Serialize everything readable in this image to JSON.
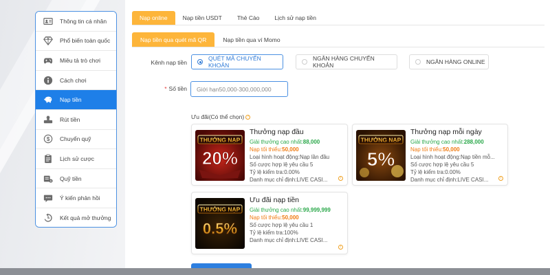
{
  "sidebar": {
    "items": [
      {
        "label": "Thông tin cá nhân",
        "icon": "user-card-icon",
        "active": false
      },
      {
        "label": "Phổ biến toàn quốc",
        "icon": "diamond-icon",
        "active": false
      },
      {
        "label": "Miêu tả trò chơi",
        "icon": "gamepad-icon",
        "active": false
      },
      {
        "label": "Cách chơi",
        "icon": "info-icon",
        "active": false
      },
      {
        "label": "Nạp tiền",
        "icon": "piggy-bank-icon",
        "active": true
      },
      {
        "label": "Rút tiền",
        "icon": "withdraw-icon",
        "active": false
      },
      {
        "label": "Chuyển quỹ",
        "icon": "dollar-icon",
        "active": false
      },
      {
        "label": "Lịch sử cược",
        "icon": "clipboard-icon",
        "active": false
      },
      {
        "label": "Quỹ tiền",
        "icon": "money-stack-icon",
        "active": false
      },
      {
        "label": "Ý kiến phản hồi",
        "icon": "chat-icon",
        "active": false
      },
      {
        "label": "Kết quả mở thưởng",
        "icon": "history-icon",
        "active": false
      }
    ],
    "active_color": "#1e7fe8"
  },
  "tabs": [
    {
      "label": "Nạp online",
      "active": true
    },
    {
      "label": "Nạp tiền USDT",
      "active": false
    },
    {
      "label": "Thẻ Cào",
      "active": false
    },
    {
      "label": "Lịch sử nạp tiền",
      "active": false
    }
  ],
  "subtabs": [
    {
      "label": "Nạp tiền qua quét mã QR",
      "active": true
    },
    {
      "label": "Nạp tiền qua ví Momo",
      "active": false
    }
  ],
  "accent_color": "#fdb53a",
  "form": {
    "channel_label": "Kênh nạp tiền",
    "channels": [
      {
        "label": "QUÉT MÃ CHUYỂN KHOẢN",
        "checked": true
      },
      {
        "label": "NGÂN HÀNG CHUYỂN KHOẢN",
        "checked": false
      },
      {
        "label": "NGÂN HÀNG ONLINE",
        "checked": false
      }
    ],
    "amount_required": "*",
    "amount_label": "Số tiền",
    "amount_placeholder": "Giới hạn50,000-300,000,000"
  },
  "promos": {
    "title": "Ưu đãi(Có thể chọn)",
    "info_glyph": "?",
    "cards": [
      {
        "title": "Thưởng nạp đầu",
        "max_label": "Giải thưởng cao nhất:",
        "max_value": "88,000",
        "min_label": "Nạp tối thiểu:",
        "min_value": "50,000",
        "line1": "Loại hình hoạt động:Nạp lần đầu",
        "line2": "Số cược hợp lệ yêu cầu 5",
        "line3": "Tỷ lệ kiểm tra:0.00%",
        "line4": "Danh mục chỉ định:LIVE CASI...",
        "badge_top": "THƯỞNG NẠP",
        "badge_big": "20%",
        "icon": "info-icon"
      },
      {
        "title": "Thưởng nạp mỗi ngày",
        "max_label": "Giải thưởng cao nhất:",
        "max_value": "288,000",
        "min_label": "Nạp tối thiểu:",
        "min_value": "50,000",
        "line1": "Loại hình hoạt động:Nạp tiền mỗ...",
        "line2": "Số cược hợp lệ yêu cầu 5",
        "line3": "Tỷ lệ kiểm tra:0.00%",
        "line4": "Danh mục chỉ định:LIVE CASI...",
        "badge_top": "THƯỞNG NẠP",
        "badge_big": "5%",
        "icon": "info-icon"
      },
      {
        "title": "Ưu đãi nạp tiền",
        "max_label": "Giải thưởng cao nhất:",
        "max_value": "99,999,999",
        "min_label": "Nạp tối thiểu:",
        "min_value": "50,000",
        "line1": "Số cược hợp lệ yêu cầu 1",
        "line2": "Tỷ lệ kiểm tra:100%",
        "line3": "Danh mục chỉ định:LIVE CASI...",
        "line4": "",
        "badge_top": "THƯỞNG NẠP",
        "badge_big": "0.5%",
        "icon": "info-icon"
      }
    ]
  }
}
